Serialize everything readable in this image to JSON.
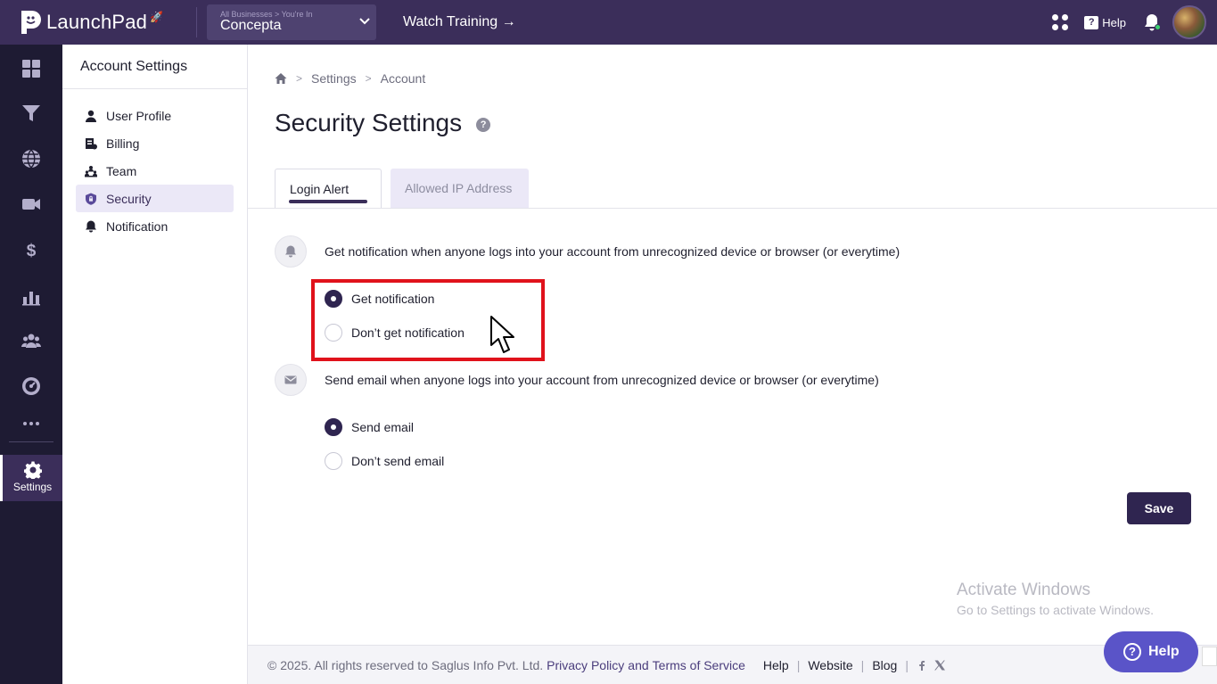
{
  "topbar": {
    "brand": "LaunchPad",
    "business_small": "All Businesses > You're In",
    "business_name": "Concepta",
    "watch_training": "Watch Training →",
    "help": "Help"
  },
  "rail": {
    "settings_label": "Settings",
    "icons": [
      "dashboard-icon",
      "funnel-icon",
      "globe-icon",
      "video-icon",
      "dollar-icon",
      "chart-icon",
      "users-icon",
      "gauge-icon",
      "more-icon"
    ]
  },
  "subnav": {
    "title": "Account Settings",
    "items": [
      {
        "label": "User Profile",
        "icon": "user-icon"
      },
      {
        "label": "Billing",
        "icon": "billing-icon"
      },
      {
        "label": "Team",
        "icon": "team-icon"
      },
      {
        "label": "Security",
        "icon": "shield-icon",
        "active": true
      },
      {
        "label": "Notification",
        "icon": "bell-icon"
      }
    ]
  },
  "breadcrumb": {
    "items": [
      "Settings",
      "Account"
    ]
  },
  "page": {
    "title": "Security Settings",
    "tabs": [
      {
        "label": "Login Alert",
        "active": true
      },
      {
        "label": "Allowed IP Address",
        "active": false
      }
    ],
    "notification_section": {
      "text": "Get notification when anyone logs into your account from unrecognized device or browser (or everytime)",
      "options": [
        {
          "label": "Get notification",
          "checked": true
        },
        {
          "label": "Don’t get notification",
          "checked": false
        }
      ]
    },
    "email_section": {
      "text": "Send email when anyone logs into your account from unrecognized device or browser (or everytime)",
      "options": [
        {
          "label": "Send email",
          "checked": true
        },
        {
          "label": "Don’t send email",
          "checked": false
        }
      ]
    },
    "save_label": "Save"
  },
  "watermark": {
    "line1": "Activate Windows",
    "line2": "Go to Settings to activate Windows."
  },
  "footer": {
    "copyright": "©  2025. All rights reserved to Saglus Info Pvt. Ltd.",
    "privacy": "Privacy Policy",
    "and": "and",
    "terms": "Terms of Service",
    "help": "Help",
    "website": "Website",
    "blog": "Blog"
  },
  "help_float": {
    "label": "Help"
  },
  "colors": {
    "topbar": "#3b2e5a",
    "rail": "#1e1b33",
    "accent": "#2f2550",
    "highlight": "#e0121b",
    "help_button": "#5a54c8"
  }
}
